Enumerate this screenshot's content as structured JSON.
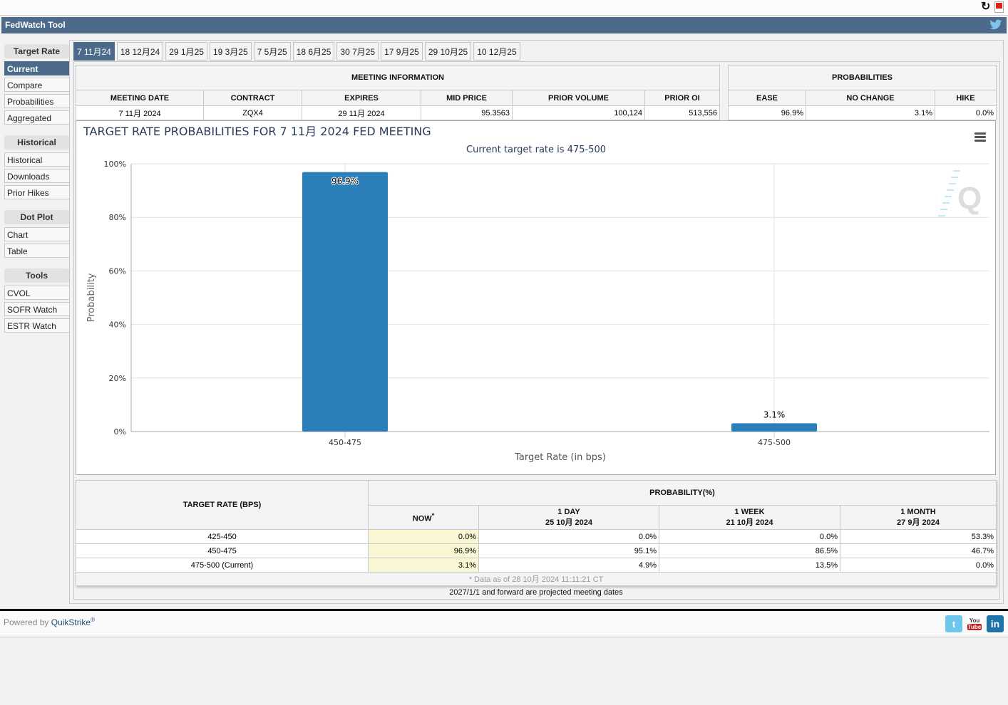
{
  "app": {
    "title": "FedWatch Tool"
  },
  "sidebar": {
    "sections": [
      {
        "heading": "Target Rate",
        "items": [
          {
            "label": "Current",
            "active": true
          },
          {
            "label": "Compare"
          },
          {
            "label": "Probabilities"
          },
          {
            "label": "Aggregated"
          }
        ]
      },
      {
        "heading": "Historical",
        "items": [
          {
            "label": "Historical"
          },
          {
            "label": "Downloads"
          },
          {
            "label": "Prior Hikes"
          }
        ]
      },
      {
        "heading": "Dot Plot",
        "items": [
          {
            "label": "Chart"
          },
          {
            "label": "Table"
          }
        ]
      },
      {
        "heading": "Tools",
        "items": [
          {
            "label": "CVOL"
          },
          {
            "label": "SOFR Watch"
          },
          {
            "label": "ESTR Watch"
          }
        ]
      }
    ]
  },
  "tabs": [
    "7 11月24",
    "18 12月24",
    "29 1月25",
    "19 3月25",
    "7 5月25",
    "18 6月25",
    "30 7月25",
    "17 9月25",
    "29 10月25",
    "10 12月25"
  ],
  "active_tab": 0,
  "meeting_info": {
    "title": "MEETING INFORMATION",
    "headers": [
      "MEETING DATE",
      "CONTRACT",
      "EXPIRES",
      "MID PRICE",
      "PRIOR VOLUME",
      "PRIOR OI"
    ],
    "row": [
      "7 11月 2024",
      "ZQX4",
      "29 11月 2024",
      "95.3563",
      "100,124",
      "513,556"
    ]
  },
  "probabilities": {
    "title": "PROBABILITIES",
    "headers": [
      "EASE",
      "NO CHANGE",
      "HIKE"
    ],
    "row": [
      "96.9%",
      "3.1%",
      "0.0%"
    ]
  },
  "chart_data": {
    "type": "bar",
    "title": "TARGET RATE PROBABILITIES FOR 7 11月 2024 FED MEETING",
    "subtitle": "Current target rate is 475-500",
    "xlabel": "Target Rate (in bps)",
    "ylabel": "Probability",
    "categories": [
      "450-475",
      "475-500"
    ],
    "values": [
      96.9,
      3.1
    ],
    "data_labels": [
      "96.9%",
      "3.1%"
    ],
    "ylim": [
      0,
      100
    ],
    "yticks": [
      "0%",
      "20%",
      "40%",
      "60%",
      "80%",
      "100%"
    ],
    "ytick_values": [
      0,
      20,
      40,
      60,
      80,
      100
    ],
    "grid": true,
    "bar_color": "#2a7fb8"
  },
  "bottom_table": {
    "rate_header": "TARGET RATE (BPS)",
    "prob_header": "PROBABILITY(%)",
    "columns": [
      {
        "label": "NOW",
        "sup": "*",
        "date": ""
      },
      {
        "label": "1 DAY",
        "date": "25 10月 2024"
      },
      {
        "label": "1 WEEK",
        "date": "21 10月 2024"
      },
      {
        "label": "1 MONTH",
        "date": "27 9月 2024"
      }
    ],
    "rows": [
      {
        "rate": "425-450",
        "values": [
          "0.0%",
          "0.0%",
          "0.0%",
          "53.3%"
        ]
      },
      {
        "rate": "450-475",
        "values": [
          "96.9%",
          "95.1%",
          "86.5%",
          "46.7%"
        ]
      },
      {
        "rate": "475-500 (Current)",
        "values": [
          "3.1%",
          "4.9%",
          "13.5%",
          "0.0%"
        ]
      }
    ],
    "footnote": "* Data as of 28 10月 2024 11:11:21 CT"
  },
  "projected_note": "2027/1/1 and forward are projected meeting dates",
  "footer": {
    "powered_by": "Powered by",
    "brand": "QuikStrike",
    "reg": "®"
  },
  "social": [
    "twitter",
    "youtube",
    "linkedin"
  ]
}
